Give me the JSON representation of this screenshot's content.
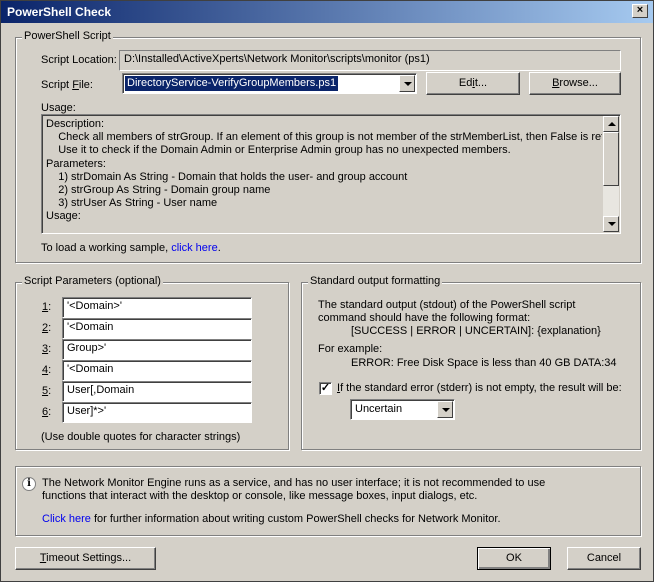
{
  "window": {
    "title": "PowerShell Check",
    "close_glyph": "×"
  },
  "script_group": {
    "legend": "PowerShell Script",
    "location_label": "Script Location:",
    "location_value": "D:\\Installed\\ActiveXperts\\Network Monitor\\scripts\\monitor (ps1)",
    "file_label_pre": "Script ",
    "file_label_accel": "F",
    "file_label_post": "ile:",
    "file_value": "DirectoryService-VerifyGroupMembers.ps1",
    "edit_pre": "Ed",
    "edit_accel": "i",
    "edit_post": "t...",
    "browse_pre": "",
    "browse_accel": "B",
    "browse_post": "rowse...",
    "usage_label": "Usage:",
    "usage_lines": [
      "Description:",
      "    Check all members of strGroup. If an element of this group is not member of the strMemberList, then False is retu",
      "    Use it to check if the Domain Admin or Enterprise Admin group has no unexpected members.",
      "Parameters:",
      "    1) strDomain As String - Domain that holds the user- and group account",
      "    2) strGroup As String - Domain group name",
      "    3) strUser As String - User name",
      "Usage:"
    ],
    "sample_text": "To load a working sample, ",
    "sample_link": "click here",
    "sample_tail": "."
  },
  "params_group": {
    "legend": "Script Parameters (optional)",
    "params": [
      {
        "num": "1",
        "value": "'<Domain>'"
      },
      {
        "num": "2",
        "value": "'<Domain"
      },
      {
        "num": "3",
        "value": "Group>'"
      },
      {
        "num": "4",
        "value": "'<Domain"
      },
      {
        "num": "5",
        "value": "User[,Domain"
      },
      {
        "num": "6",
        "value": "User]*>'"
      }
    ],
    "hint": "(Use double quotes for character strings)"
  },
  "output_group": {
    "legend": "Standard output formatting",
    "line1": "The standard output (stdout) of the PowerShell script",
    "line2": "command should have the following format:",
    "format": "[SUCCESS | ERROR | UNCERTAIN]: {explanation}",
    "example_label": "For example:",
    "example": "ERROR: Free Disk Space is less than 40 GB DATA:34",
    "stderr_checked": true,
    "check_glyph": "✓",
    "stderr_accel": "I",
    "stderr_text": "f the standard error (stderr) is not empty, the result will be:",
    "result_value": "Uncertain"
  },
  "info": {
    "icon_glyph": "i",
    "line1": "The Network Monitor Engine runs as a service, and has no user interface; it is not recommended to use",
    "line2": "functions that interact with the desktop or console, like message boxes, input dialogs, etc.",
    "link": "Click here",
    "link_tail": " for further information about writing custom PowerShell checks for Network Monitor."
  },
  "buttons": {
    "timeout_accel": "T",
    "timeout_rest": "imeout Settings...",
    "ok": "OK",
    "cancel": "Cancel"
  }
}
